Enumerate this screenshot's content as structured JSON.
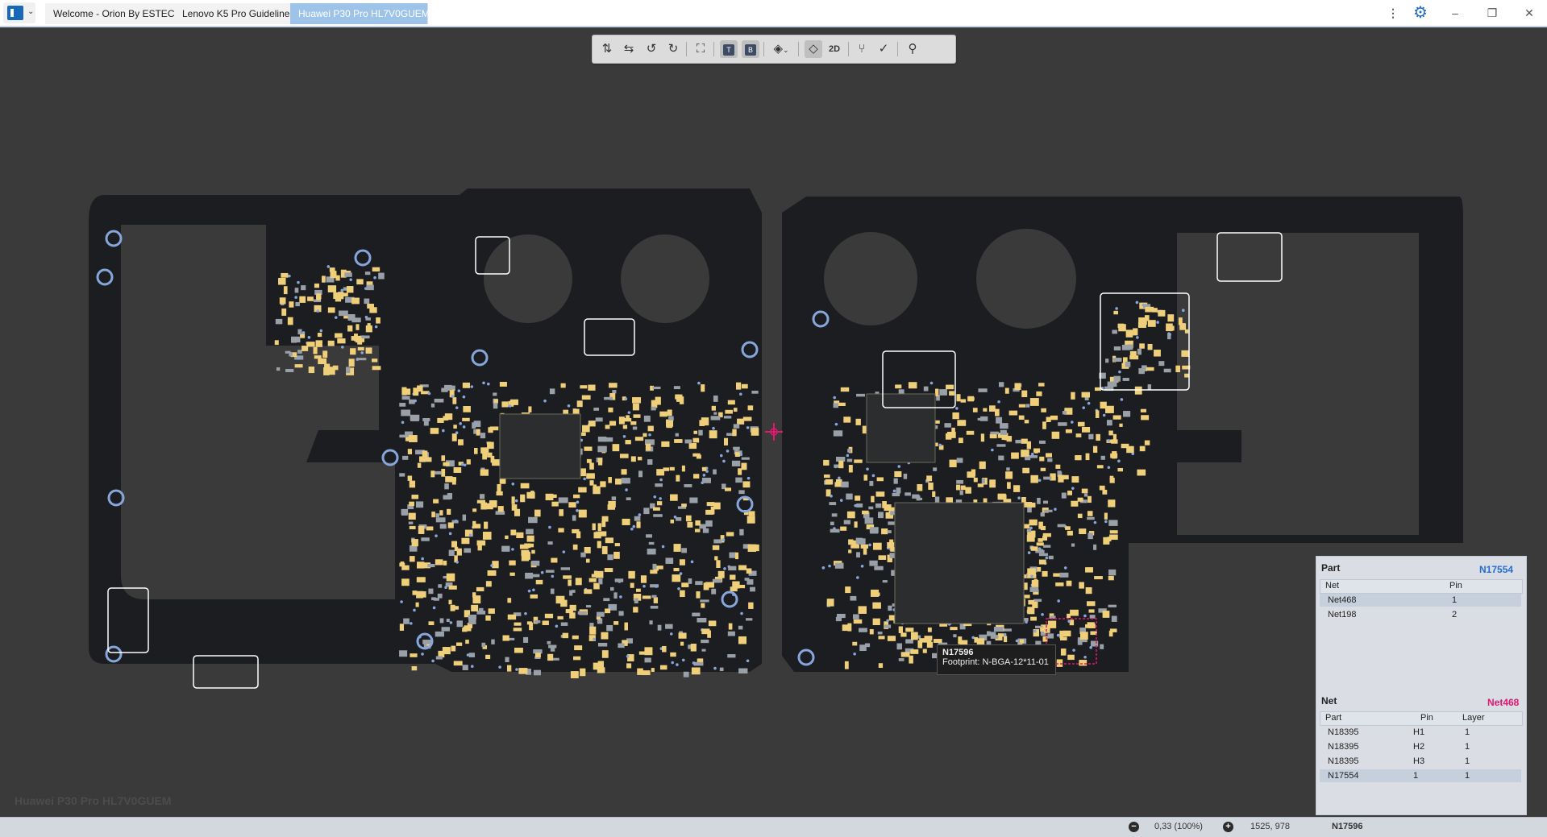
{
  "tabs": [
    {
      "label": "Welcome - Orion By ESTECH",
      "active": false
    },
    {
      "label": "Lenovo K5 Pro Guideline",
      "active": false
    },
    {
      "label": "Huawei P30 Pro HL7V0GUEM",
      "active": true
    }
  ],
  "window": {
    "more_icon": "more-vertical-icon",
    "gear_icon": "gear-icon",
    "minimize_label": "–",
    "maximize_label": "❐",
    "close_label": "✕"
  },
  "toolbar": {
    "top_layer_label": "T",
    "bottom_layer_label": "B",
    "view_2d_label": "2D",
    "icons": [
      "flip-horizontal-icon",
      "flip-vertical-icon",
      "rotate-left-icon",
      "rotate-right-icon",
      "fit-screen-icon",
      "top-layer-icon",
      "bottom-layer-icon",
      "layers-icon",
      "parts-icon",
      "view-2d-icon",
      "net-route-icon",
      "measure-icon",
      "search-icon"
    ]
  },
  "board": {
    "watermark": "Huawei P30 Pro HL7V0GUEM",
    "colors": {
      "pcb": "#1b1d21",
      "pad": "#f0cf7a",
      "via": "#86a6dc",
      "component": "#9aa0a8",
      "silkscreen": "#ffffff",
      "highlight": "#e0186e"
    }
  },
  "tooltip": {
    "part": "N17596",
    "footprint": "Footprint: N-BGA-12*11-01"
  },
  "part_panel": {
    "title": "Part",
    "part_name": "N17554",
    "columns": [
      "Net",
      "Pin"
    ],
    "rows": [
      {
        "net": "Net468",
        "pin": "1",
        "selected": true
      },
      {
        "net": "Net198",
        "pin": "2",
        "selected": false
      }
    ]
  },
  "net_panel": {
    "title": "Net",
    "net_name": "Net468",
    "columns": [
      "Part",
      "Pin",
      "Layer"
    ],
    "rows": [
      {
        "part": "N18395",
        "pin": "H1",
        "layer": "1",
        "selected": false
      },
      {
        "part": "N18395",
        "pin": "H2",
        "layer": "1",
        "selected": false
      },
      {
        "part": "N18395",
        "pin": "H3",
        "layer": "1",
        "selected": false
      },
      {
        "part": "N17554",
        "pin": "1",
        "layer": "1",
        "selected": true
      }
    ]
  },
  "status": {
    "zoom_out_label": "−",
    "zoom": "0,33 (100%)",
    "zoom_in_label": "+",
    "coords": "1525, 978",
    "selected_part": "N17596"
  }
}
